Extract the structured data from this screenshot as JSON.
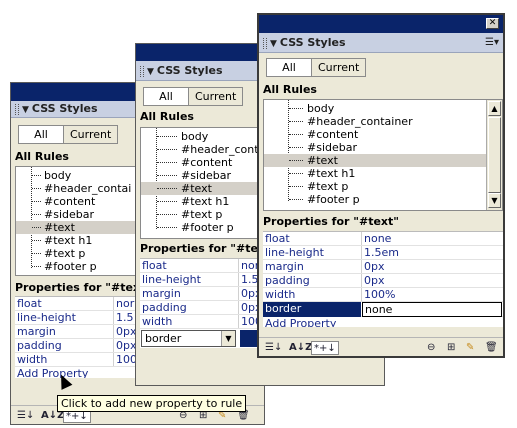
{
  "panel_title": "CSS Styles",
  "tabs": {
    "all": "All",
    "current": "Current"
  },
  "all_rules_label": "All Rules",
  "rules": [
    "body",
    "#header_container",
    "#content",
    "#sidebar",
    "#text",
    "#text h1",
    "#text p",
    "#footer p"
  ],
  "rules_truncated_p1": [
    "body",
    "#header_contai",
    "#content",
    "#sidebar",
    "#text",
    "#text h1",
    "#text p",
    "#footer p"
  ],
  "rules_truncated_p2": [
    "body",
    "#header_contai",
    "#content",
    "#sidebar",
    "#text",
    "#text h1",
    "#text p",
    "#footer p"
  ],
  "properties_label": "Properties for \"#text\"",
  "properties": [
    {
      "name": "float",
      "value": "none"
    },
    {
      "name": "line-height",
      "value": "1.5em"
    },
    {
      "name": "margin",
      "value": "0px"
    },
    {
      "name": "padding",
      "value": "0px"
    },
    {
      "name": "width",
      "value": "100%"
    }
  ],
  "p1_values": [
    "nor",
    "1.5",
    "0px",
    "0px",
    "100"
  ],
  "p2_values": [
    "nor",
    "1.5",
    "0px",
    "0px",
    "100"
  ],
  "border_prop": {
    "name": "border",
    "value": "none"
  },
  "border_input_value": "border",
  "add_property": "Add Property",
  "tooltip": "Click to add new property to rule",
  "toolbar": {
    "az": "A↓Z",
    "star": "*+↓",
    "list": "☰↓"
  },
  "colors": {
    "title_bar": "#0a246a",
    "header": "#c8d0e2",
    "selected_row": "#d4d0c8",
    "prop_text": "#1a2a8a"
  }
}
